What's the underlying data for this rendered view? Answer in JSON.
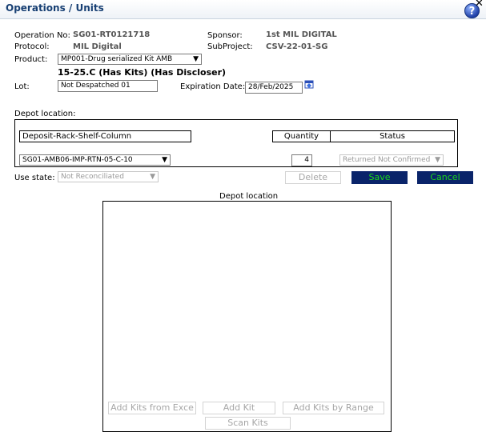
{
  "header": {
    "title": "Operations / Units",
    "help": "?",
    "close": "✕"
  },
  "info": {
    "operation_no_label": "Operation No:",
    "operation_no": "SG01-RT0121718",
    "sponsor_label": "Sponsor:",
    "sponsor": "1st MIL DIGITAL",
    "protocol_label": "Protocol:",
    "protocol": "MIL Digital",
    "subproject_label": "SubProject:",
    "subproject": "CSV-22-01-SG",
    "product_label": "Product:",
    "product_value": "MP001-Drug serialized Kit AMB",
    "storage": "15-25.C  (Has Kits)  (Has Discloser)",
    "lot_label": "Lot:",
    "lot_value": "Not Despatched 01",
    "expiration_label": "Expiration Date:",
    "expiration_value": "28/Feb/2025"
  },
  "depot": {
    "label": "Depot location:",
    "col_location": "Deposit-Rack-Shelf-Column",
    "col_quantity": "Quantity",
    "col_status": "Status",
    "location_value": "SG01-AMB06-IMP-RTN-05-C-10",
    "quantity_value": "4",
    "status_value": "Returned Not Confirmed"
  },
  "use_state": {
    "label": "Use state:",
    "value": "Not Reconciliated"
  },
  "actions": {
    "delete": "Delete",
    "save": "Save",
    "cancel": "Cancel"
  },
  "map": {
    "title": "Depot location",
    "add_from_excel": "Add Kits from Exce",
    "add_kit": "Add Kit",
    "add_range": "Add Kits by Range",
    "scan": "Scan Kits"
  },
  "colors": {
    "title": "#173f73",
    "button_bg": "#0a246a",
    "button_text": "#1ad61a"
  }
}
